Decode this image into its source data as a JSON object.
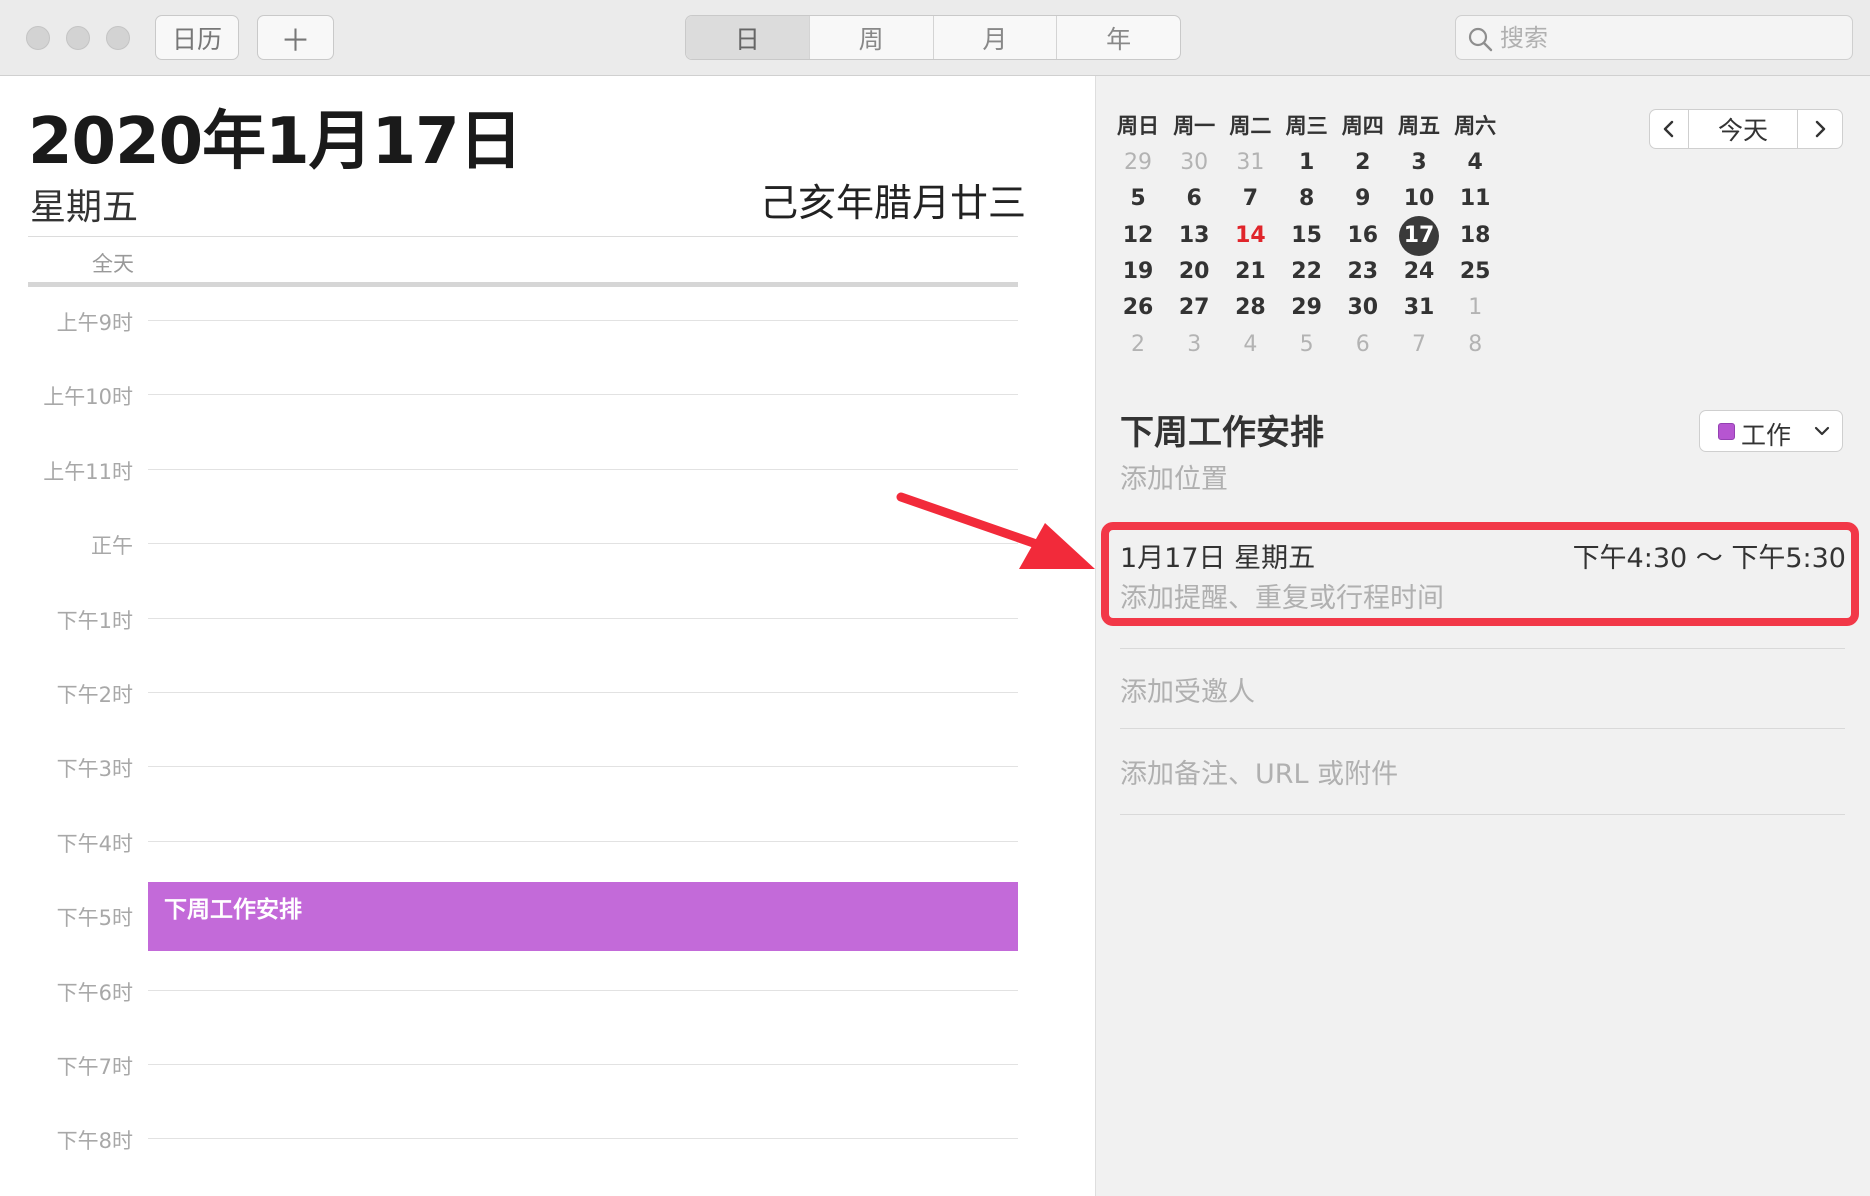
{
  "toolbar": {
    "calendars_label": "日历",
    "add_label": "＋",
    "views": [
      {
        "label": "日",
        "active": true
      },
      {
        "label": "周",
        "active": false
      },
      {
        "label": "月",
        "active": false
      },
      {
        "label": "年",
        "active": false
      }
    ],
    "search_placeholder": "搜索"
  },
  "day_view": {
    "date_title": "2020年1月17日",
    "weekday": "星期五",
    "lunar": "己亥年腊月廿三",
    "all_day_label": "全天",
    "hours": [
      "上午9时",
      "上午10时",
      "上午11时",
      "正午",
      "下午1时",
      "下午2时",
      "下午3时",
      "下午4时",
      "下午5时",
      "下午6时",
      "下午7时",
      "下午8时"
    ],
    "event": {
      "title": "下周工作安排",
      "color": "#c36ad9"
    }
  },
  "mini_calendar": {
    "weekdays": [
      "周日",
      "周一",
      "周二",
      "周三",
      "周四",
      "周五",
      "周六"
    ],
    "weeks": [
      [
        {
          "d": "29",
          "other": true
        },
        {
          "d": "30",
          "other": true
        },
        {
          "d": "31",
          "other": true
        },
        {
          "d": "1"
        },
        {
          "d": "2"
        },
        {
          "d": "3"
        },
        {
          "d": "4"
        }
      ],
      [
        {
          "d": "5"
        },
        {
          "d": "6"
        },
        {
          "d": "7"
        },
        {
          "d": "8"
        },
        {
          "d": "9"
        },
        {
          "d": "10"
        },
        {
          "d": "11"
        }
      ],
      [
        {
          "d": "12"
        },
        {
          "d": "13"
        },
        {
          "d": "14",
          "today": true
        },
        {
          "d": "15"
        },
        {
          "d": "16"
        },
        {
          "d": "17",
          "selected": true
        },
        {
          "d": "18"
        }
      ],
      [
        {
          "d": "19"
        },
        {
          "d": "20"
        },
        {
          "d": "21"
        },
        {
          "d": "22"
        },
        {
          "d": "23"
        },
        {
          "d": "24"
        },
        {
          "d": "25"
        }
      ],
      [
        {
          "d": "26"
        },
        {
          "d": "27"
        },
        {
          "d": "28"
        },
        {
          "d": "29"
        },
        {
          "d": "30"
        },
        {
          "d": "31"
        },
        {
          "d": "1",
          "other": true
        }
      ],
      [
        {
          "d": "2",
          "other": true
        },
        {
          "d": "3",
          "other": true
        },
        {
          "d": "4",
          "other": true
        },
        {
          "d": "5",
          "other": true
        },
        {
          "d": "6",
          "other": true
        },
        {
          "d": "7",
          "other": true
        },
        {
          "d": "8",
          "other": true
        }
      ]
    ],
    "today_button": "今天",
    "today_color": "#e0252b"
  },
  "event_detail": {
    "title": "下周工作安排",
    "location_placeholder": "添加位置",
    "calendar_name": "工作",
    "calendar_color": "#b655d1",
    "date": "1月17日 星期五",
    "time": "下午4:30 ～ 下午5:30",
    "alert_placeholder": "添加提醒、重复或行程时间",
    "invitees_placeholder": "添加受邀人",
    "notes_placeholder": "添加备注、URL 或附件"
  },
  "annotation": {
    "highlight_color": "#f23848",
    "arrow_color": "#f22a3a"
  }
}
